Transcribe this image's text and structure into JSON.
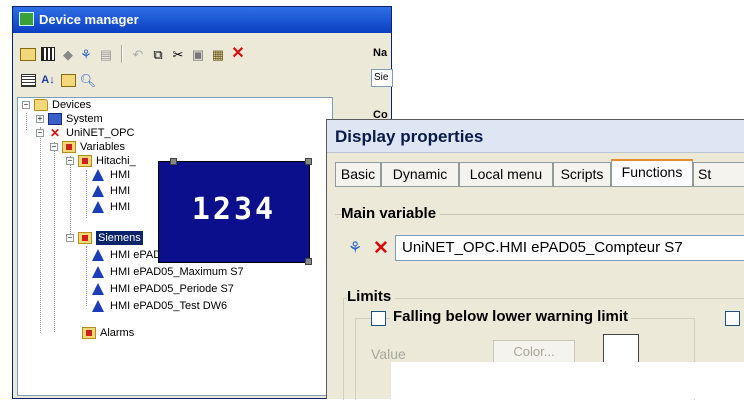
{
  "device_manager": {
    "title": "Device manager",
    "right_label_1": "Na",
    "right_field_1": "Sie",
    "right_label_2": "Co",
    "tree": {
      "devices": "Devices",
      "system": "System",
      "uninet": "UniNET_OPC",
      "variables": "Variables",
      "hitachi": "Hitachi_",
      "hmi_1": "HMI",
      "hmi_2": "HMI",
      "hmi_3": "HMI",
      "siemens": "Siemens",
      "siemens_items": [
        "HMI ePAD05_Compteur S7",
        "HMI ePAD05_Maximum S7",
        "HMI ePAD05_Periode S7",
        "HMI ePAD05_Test DW6"
      ],
      "alarms": "Alarms"
    }
  },
  "display_widget": {
    "digits": "1234"
  },
  "display_properties": {
    "title": "Display properties",
    "tabs": [
      "Basic",
      "Dynamic",
      "Local menu",
      "Scripts",
      "Functions",
      "St"
    ],
    "active_tab": "Functions",
    "main_variable_label": "Main variable",
    "main_variable_value": "UniNET_OPC.HMI ePAD05_Compteur S7",
    "limits_label": "Limits",
    "falling_below_label": "Falling below lower warning limit",
    "value_label": "Value",
    "color_button": "Color..."
  },
  "colors": {
    "titlebar": "#0a3fc2",
    "display_bg": "#0c0f8c",
    "selection": "#0a246a",
    "delete_red": "#d01010"
  }
}
